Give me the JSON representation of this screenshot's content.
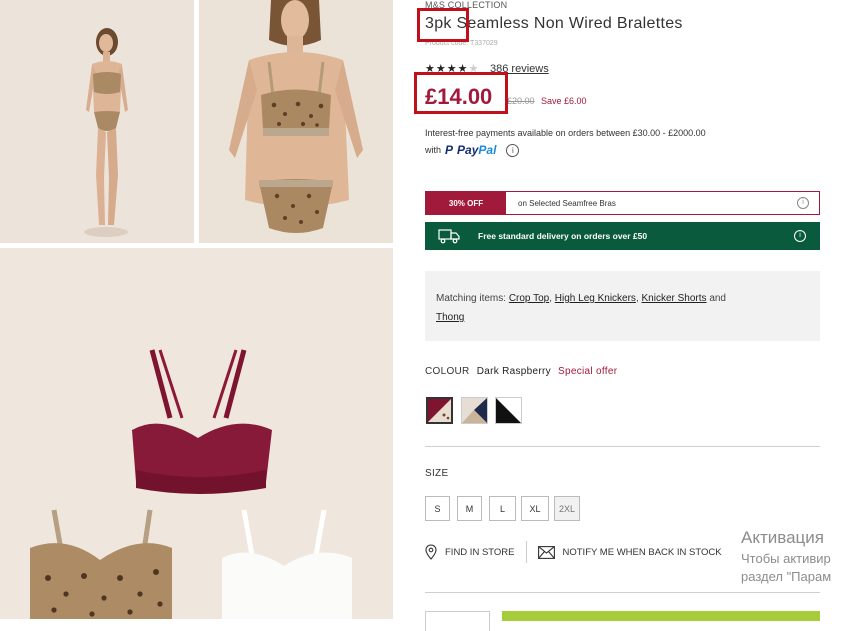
{
  "product": {
    "brand": "M&S COLLECTION",
    "title": "3pk Seamless Non Wired Bralettes",
    "product_code": "Product code: T337029",
    "rating_stars": "★★★★",
    "rating_empty": "★",
    "rating_value": 4,
    "reviews_label": "386 reviews",
    "price": "£14.00",
    "was_price": "£20.00",
    "save_label": "Save £6.00"
  },
  "finance": {
    "line1": "Interest-free payments available on orders between £30.00 - £2000.00",
    "with_label": "with",
    "paypal_p": "P",
    "paypal_a": "Pay",
    "paypal_b": "Pal"
  },
  "offer": {
    "tag": "30% OFF",
    "text": "on Selected Seamfree Bras"
  },
  "delivery": {
    "text": "Free standard delivery on orders over £50"
  },
  "matching": {
    "label": "Matching items:",
    "items": [
      "Crop Top",
      "High Leg Knickers",
      "Knicker Shorts",
      "Thong"
    ],
    "sep1": ",",
    "sep2": ",",
    "and_label": "and"
  },
  "colour": {
    "label": "COLOUR",
    "selected": "Dark Raspberry",
    "special": "Special offer",
    "swatches": [
      "dark-raspberry",
      "neutral-navy-mix",
      "black-white-mix"
    ]
  },
  "size": {
    "label": "SIZE",
    "options": [
      "S",
      "M",
      "L",
      "XL",
      "2XL"
    ],
    "unavailable": [
      "2XL"
    ]
  },
  "store": {
    "find": "FIND IN STORE",
    "notify": "NOTIFY ME WHEN BACK IN STOCK"
  },
  "watermark": {
    "line1": "Активация",
    "line2": "Чтобы активир",
    "line3": "раздел \"Парам"
  },
  "colors": {
    "accent": "#a21a3b",
    "delivery_green": "#0a5a3e",
    "add_to_bag": "#a7cc3a",
    "highlight": "#c0101c"
  }
}
